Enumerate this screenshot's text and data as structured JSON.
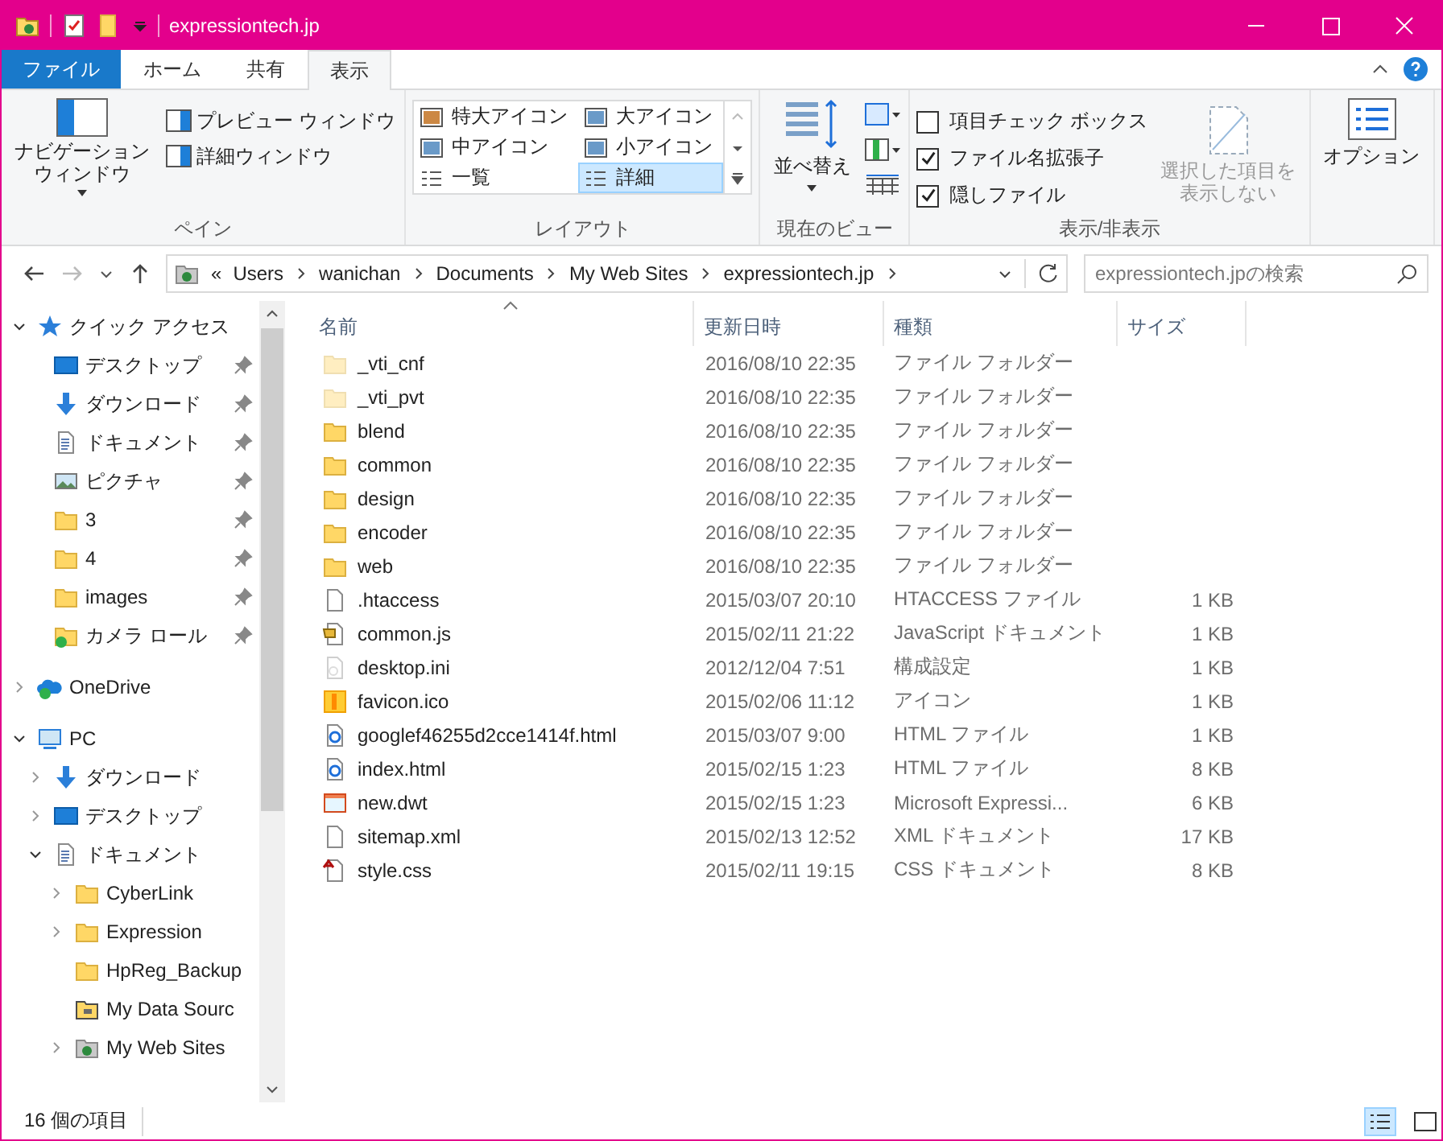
{
  "window": {
    "title": "expressiontech.jp"
  },
  "ribbon_tabs": [
    {
      "label": "ファイル",
      "kind": "file",
      "selected": false
    },
    {
      "label": "ホーム",
      "kind": "tab",
      "selected": false
    },
    {
      "label": "共有",
      "kind": "tab",
      "selected": false
    },
    {
      "label": "表示",
      "kind": "tab",
      "selected": true
    }
  ],
  "panes": {
    "navigation_pane": [
      "ナビゲーション",
      "ウィンドウ"
    ],
    "preview_pane": "プレビュー ウィンドウ",
    "details_pane": "詳細ウィンドウ",
    "label": "ペイン"
  },
  "layout": {
    "options": [
      {
        "label": "特大アイコン",
        "selected": false
      },
      {
        "label": "大アイコン",
        "selected": false
      },
      {
        "label": "中アイコン",
        "selected": false
      },
      {
        "label": "小アイコン",
        "selected": false
      },
      {
        "label": "一覧",
        "selected": false
      },
      {
        "label": "詳細",
        "selected": true
      }
    ],
    "label": "レイアウト"
  },
  "current_view": {
    "sort_by": "並べ替え",
    "label": "現在のビュー"
  },
  "show_hide": {
    "checkboxes": [
      {
        "label": "項目チェック ボックス",
        "checked": false
      },
      {
        "label": "ファイル名拡張子",
        "checked": true
      },
      {
        "label": "隠しファイル",
        "checked": true
      }
    ],
    "hide_selected": [
      "選択した項目を",
      "表示しない"
    ],
    "hide_selected_disabled": true,
    "label": "表示/非表示"
  },
  "options": {
    "label": "オプション"
  },
  "address_bar": {
    "overflow": "«",
    "path": [
      "Users",
      "wanichan",
      "Documents",
      "My Web Sites",
      "expressiontech.jp"
    ]
  },
  "search": {
    "placeholder": "expressiontech.jpの検索"
  },
  "sidebar": {
    "items": [
      {
        "label": "クイック アクセス",
        "kind": "star",
        "expanded": true,
        "children": [
          {
            "label": "デスクトップ",
            "kind": "desktop",
            "pinned": true
          },
          {
            "label": "ダウンロード",
            "kind": "download",
            "pinned": true
          },
          {
            "label": "ドキュメント",
            "kind": "document",
            "pinned": true
          },
          {
            "label": "ピクチャ",
            "kind": "picture",
            "pinned": true
          },
          {
            "label": "3",
            "kind": "folder",
            "pinned": true
          },
          {
            "label": "4",
            "kind": "folder",
            "pinned": true
          },
          {
            "label": "images",
            "kind": "folder",
            "pinned": true
          },
          {
            "label": "カメラ ロール",
            "kind": "synced-folder",
            "pinned": true
          }
        ]
      },
      {
        "label": "OneDrive",
        "kind": "cloud",
        "expanded": false
      },
      {
        "label": "PC",
        "kind": "pc",
        "expanded": true,
        "children": [
          {
            "label": "ダウンロード",
            "kind": "download",
            "expanded": false
          },
          {
            "label": "デスクトップ",
            "kind": "desktop",
            "expanded": false
          },
          {
            "label": "ドキュメント",
            "kind": "document",
            "expanded": true,
            "children": [
              {
                "label": "CyberLink",
                "kind": "folder",
                "expanded": false
              },
              {
                "label": "Expression",
                "kind": "folder",
                "expanded": false
              },
              {
                "label": "HpReg_Backup",
                "kind": "folder"
              },
              {
                "label": "My Data Sourc",
                "kind": "data-folder"
              },
              {
                "label": "My Web Sites",
                "kind": "web-folder",
                "expanded": false
              }
            ]
          }
        ]
      }
    ]
  },
  "file_list": {
    "columns": [
      "名前",
      "更新日時",
      "種類",
      "サイズ"
    ],
    "rows": [
      {
        "name": "_vti_cnf",
        "modified": "2016/08/10 22:35",
        "type": "ファイル フォルダー",
        "kind": "folder",
        "hidden": true
      },
      {
        "name": "_vti_pvt",
        "modified": "2016/08/10 22:35",
        "type": "ファイル フォルダー",
        "kind": "folder",
        "hidden": true
      },
      {
        "name": "blend",
        "modified": "2016/08/10 22:35",
        "type": "ファイル フォルダー",
        "kind": "folder",
        "hidden": false
      },
      {
        "name": "common",
        "modified": "2016/08/10 22:35",
        "type": "ファイル フォルダー",
        "kind": "folder",
        "hidden": false
      },
      {
        "name": "design",
        "modified": "2016/08/10 22:35",
        "type": "ファイル フォルダー",
        "kind": "folder",
        "hidden": false
      },
      {
        "name": "encoder",
        "modified": "2016/08/10 22:35",
        "type": "ファイル フォルダー",
        "kind": "folder",
        "hidden": false
      },
      {
        "name": "web",
        "modified": "2016/08/10 22:35",
        "type": "ファイル フォルダー",
        "kind": "folder",
        "hidden": false
      },
      {
        "name": ".htaccess",
        "modified": "2015/03/07 20:10",
        "type": "HTACCESS ファイル",
        "size": "1 KB",
        "kind": "file",
        "hidden": false
      },
      {
        "name": "common.js",
        "modified": "2015/02/11 21:22",
        "type": "JavaScript ドキュメント",
        "size": "1 KB",
        "kind": "script",
        "hidden": false
      },
      {
        "name": "desktop.ini",
        "modified": "2012/12/04 7:51",
        "type": "構成設定",
        "size": "1 KB",
        "kind": "settings",
        "hidden": true
      },
      {
        "name": "favicon.ico",
        "modified": "2015/02/06 11:12",
        "type": "アイコン",
        "size": "1 KB",
        "kind": "ico",
        "hidden": false
      },
      {
        "name": "googlef46255d2cce1414f.html",
        "modified": "2015/03/07 9:00",
        "type": "HTML ファイル",
        "size": "1 KB",
        "kind": "html",
        "hidden": false
      },
      {
        "name": "index.html",
        "modified": "2015/02/15 1:23",
        "type": "HTML ファイル",
        "size": "8 KB",
        "kind": "html",
        "hidden": false
      },
      {
        "name": "new.dwt",
        "modified": "2015/02/15 1:23",
        "type": "Microsoft Expressi...",
        "size": "6 KB",
        "kind": "dwt",
        "hidden": false
      },
      {
        "name": "sitemap.xml",
        "modified": "2015/02/13 12:52",
        "type": "XML ドキュメント",
        "size": "17 KB",
        "kind": "file",
        "hidden": false
      },
      {
        "name": "style.css",
        "modified": "2015/02/11 19:15",
        "type": "CSS ドキュメント",
        "size": "8 KB",
        "kind": "css",
        "hidden": false
      }
    ]
  },
  "status_bar": {
    "item_count": "16 個の項目",
    "views": [
      {
        "kind": "details",
        "selected": true
      },
      {
        "kind": "large-icons",
        "selected": false
      }
    ]
  }
}
